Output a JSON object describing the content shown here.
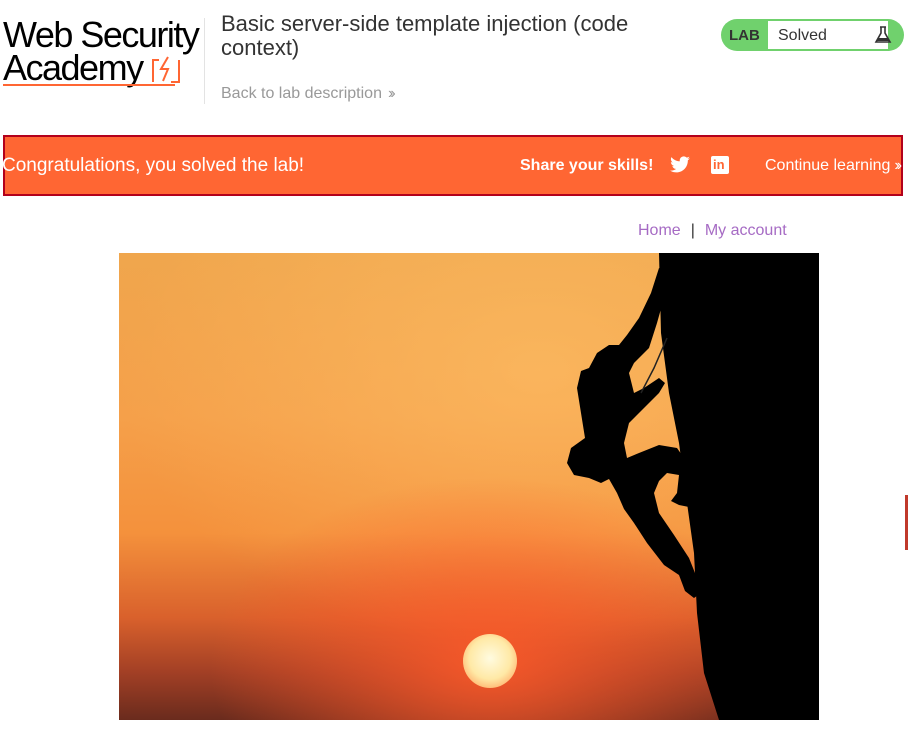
{
  "header": {
    "logo_line1": "Web Security",
    "logo_line2": "Academy",
    "lab_title": "Basic server-side template injection (code context)",
    "back_link": "Back to lab description",
    "back_icon": "double-chevron-right-icon",
    "status_label": "LAB",
    "status_value": "Solved",
    "status_icon": "flask-icon"
  },
  "banner": {
    "message": "Congratulations, you solved the lab!",
    "share_label": "Share your skills!",
    "twitter_icon": "twitter-icon",
    "linkedin_icon": "linkedin-icon",
    "continue_label": "Continue learning"
  },
  "nav": {
    "home": "Home",
    "separator": "|",
    "my_account": "My account"
  },
  "colors": {
    "accent": "#ff6633",
    "banner_border": "#b3001b",
    "status_green": "#70d16d",
    "link_purple": "#a66bc4"
  }
}
